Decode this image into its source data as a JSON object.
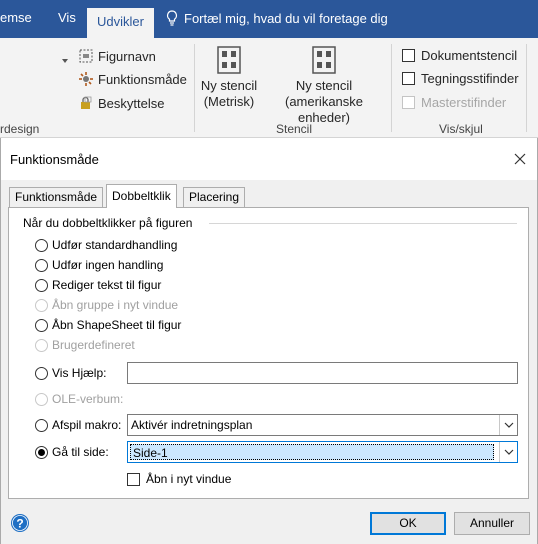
{
  "ribbon": {
    "tabs": [
      {
        "label": "emse",
        "active": false
      },
      {
        "label": "Vis",
        "active": false
      },
      {
        "label": "Udvikler",
        "active": true
      }
    ],
    "tell_me": "Fortæl mig, hvad du vil foretage dig",
    "shape_group": {
      "items": [
        {
          "label": "Figurnavn",
          "icon": "shape-name-icon"
        },
        {
          "label": "Funktionsmåde",
          "icon": "behavior-icon"
        },
        {
          "label": "Beskyttelse",
          "icon": "protection-icon"
        }
      ],
      "label": "rdesign"
    },
    "stencil_group": {
      "buttons": [
        {
          "line1": "Ny stencil",
          "line2": "(Metrisk)"
        },
        {
          "line1": "Ny stencil",
          "line2": "(amerikanske enheder)"
        }
      ],
      "label": "Stencil"
    },
    "show_hide_group": {
      "items": [
        {
          "label": "Dokumentstencil",
          "checked": false,
          "disabled": false
        },
        {
          "label": "Tegningsstifinder",
          "checked": false,
          "disabled": false
        },
        {
          "label": "Masterstifinder",
          "checked": false,
          "disabled": true
        }
      ],
      "label": "Vis/skjul"
    },
    "colors": {
      "tabbar": "#2b579a",
      "ribbon": "#f3f3f3"
    }
  },
  "dialog": {
    "title": "Funktionsmåde",
    "tabs": [
      {
        "label": "Funktionsmåde",
        "active": false
      },
      {
        "label": "Dobbeltklik",
        "active": true
      },
      {
        "label": "Placering",
        "active": false
      }
    ],
    "section_title": "Når du dobbeltklikker på figuren",
    "options": {
      "standard": "Udfør standardhandling",
      "none": "Udfør ingen handling",
      "edit_text": "Rediger tekst til figur",
      "open_group": "Åbn gruppe i nyt vindue",
      "shapesheet": "Åbn ShapeSheet til figur",
      "custom": "Brugerdefineret",
      "help": "Vis Hjælp:",
      "ole": "OLE-verbum:",
      "macro": "Afspil makro:",
      "goto": "Gå til side:"
    },
    "help_value": "",
    "macro_value": "Aktivér indretningsplan",
    "page_value": "Side-1",
    "open_new_window": "Åbn i nyt vindue",
    "selected_option": "goto",
    "buttons": {
      "ok": "OK",
      "cancel": "Annuller"
    },
    "colors": {
      "accent": "#0078d7",
      "selection": "#cce8ff"
    }
  }
}
